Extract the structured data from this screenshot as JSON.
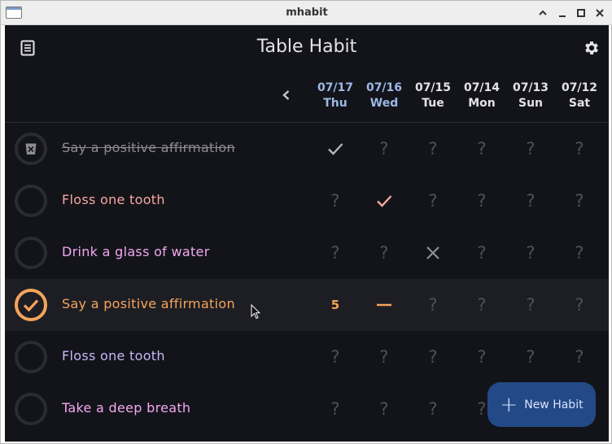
{
  "window": {
    "title": "mhabit"
  },
  "app": {
    "title": "Table Habit"
  },
  "colors": {
    "background": "#13141a",
    "today_header": "#9cb8e6",
    "fab": "#234a86",
    "check_gray": "#b5b5bb",
    "unknown": "#4f5057"
  },
  "days": [
    {
      "date": "07/17",
      "weekday": "Thu",
      "color": "#9cb8e6"
    },
    {
      "date": "07/16",
      "weekday": "Wed",
      "color": "#9cb8e6"
    },
    {
      "date": "07/15",
      "weekday": "Tue",
      "color": "#e4e2e9"
    },
    {
      "date": "07/14",
      "weekday": "Mon",
      "color": "#e4e2e9"
    },
    {
      "date": "07/13",
      "weekday": "Sun",
      "color": "#e4e2e9"
    },
    {
      "date": "07/12",
      "weekday": "Sat",
      "color": "#e4e2e9"
    }
  ],
  "habits": [
    {
      "name": "Say a positive affirmation",
      "color": "#8b8b91",
      "strike": true,
      "ring": "archived",
      "highlight": false,
      "cells": [
        {
          "type": "check",
          "color": "#b5b5bb"
        },
        {
          "type": "unknown"
        },
        {
          "type": "unknown"
        },
        {
          "type": "unknown"
        },
        {
          "type": "unknown"
        },
        {
          "type": "unknown"
        }
      ]
    },
    {
      "name": "Floss one tooth",
      "color": "#f4a7a0",
      "strike": false,
      "ring": "empty",
      "highlight": false,
      "cells": [
        {
          "type": "unknown"
        },
        {
          "type": "check",
          "color": "#f4a7a0"
        },
        {
          "type": "unknown"
        },
        {
          "type": "unknown"
        },
        {
          "type": "unknown"
        },
        {
          "type": "unknown"
        }
      ]
    },
    {
      "name": "Drink a glass of water",
      "color": "#f2a7ef",
      "strike": false,
      "ring": "empty",
      "highlight": false,
      "cells": [
        {
          "type": "unknown"
        },
        {
          "type": "unknown"
        },
        {
          "type": "cross",
          "color": "#8d8e94"
        },
        {
          "type": "unknown"
        },
        {
          "type": "unknown"
        },
        {
          "type": "unknown"
        }
      ]
    },
    {
      "name": "Say a positive affirmation",
      "color": "#f5a45a",
      "strike": false,
      "ring": "done",
      "highlight": true,
      "cells": [
        {
          "type": "number",
          "value": "5",
          "color": "#f5a45a"
        },
        {
          "type": "dash",
          "color": "#f5a45a"
        },
        {
          "type": "unknown"
        },
        {
          "type": "unknown"
        },
        {
          "type": "unknown"
        },
        {
          "type": "unknown"
        }
      ]
    },
    {
      "name": "Floss one tooth",
      "color": "#c7b5f5",
      "strike": false,
      "ring": "empty",
      "highlight": false,
      "cells": [
        {
          "type": "unknown"
        },
        {
          "type": "unknown"
        },
        {
          "type": "unknown"
        },
        {
          "type": "unknown"
        },
        {
          "type": "unknown"
        },
        {
          "type": "unknown"
        }
      ]
    },
    {
      "name": "Take a deep breath",
      "color": "#f2a7ef",
      "strike": false,
      "ring": "empty",
      "highlight": false,
      "cells": [
        {
          "type": "unknown"
        },
        {
          "type": "unknown"
        },
        {
          "type": "unknown"
        },
        {
          "type": "unknown"
        },
        {
          "type": "unknown"
        },
        {
          "type": "unknown"
        }
      ]
    }
  ],
  "fab": {
    "label": "New Habit",
    "icon": "plus-icon"
  },
  "icons": {
    "menu": "list-icon",
    "settings": "gear-icon",
    "prev": "chevron-left-icon"
  }
}
